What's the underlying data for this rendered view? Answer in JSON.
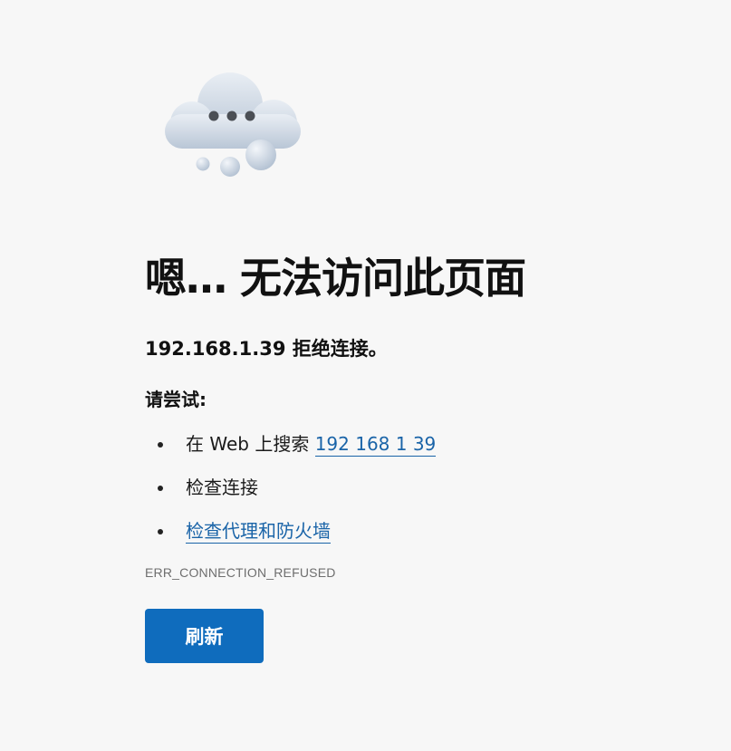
{
  "page": {
    "illustration_icon": "cloud-with-ellipsis-icon",
    "title": "嗯… 无法访问此页面",
    "subtitle": "192.168.1.39 拒绝连接。",
    "try_heading": "请尝试:",
    "suggestions": [
      {
        "prefix": "在 Web 上搜索 ",
        "link_text": "192 168 1 39"
      },
      {
        "text": "检查连接"
      },
      {
        "link_text": "检查代理和防火墙"
      }
    ],
    "error_code": "ERR_CONNECTION_REFUSED",
    "refresh_label": "刷新"
  },
  "colors": {
    "background": "#f7f7f7",
    "link": "#1a64a8",
    "button": "#0f6cbd",
    "button_text": "#ffffff",
    "error_code": "#6e6e6e"
  }
}
